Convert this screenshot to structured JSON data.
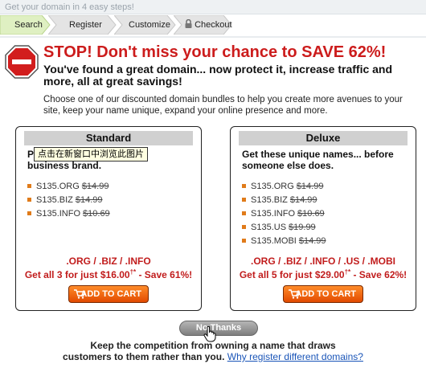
{
  "header": {
    "tagline": "Get your domain in 4 easy steps!"
  },
  "steps": [
    "Search",
    "Register",
    "Customize",
    "Checkout"
  ],
  "headline": "STOP! Don't miss your chance to SAVE 62%!",
  "subheadline": "You've found a great domain... now protect it, increase traffic and more, all at great savings!",
  "body": "Choose one of our discounted domain bundles to help you create more avenues to your site, keep your name unique, expand your online presence and more.",
  "standard": {
    "title": "Standard",
    "intro_prefix": "P",
    "intro_rest": "business brand.",
    "items": [
      {
        "name": "S135.ORG",
        "price": "$14.99"
      },
      {
        "name": "S135.BIZ",
        "price": "$14.99"
      },
      {
        "name": "S135.INFO",
        "price": "$10.69"
      }
    ],
    "tlds": ".ORG / .BIZ / .INFO",
    "deal": "Get all 3 for just $16.00",
    "deal_mark": "†*",
    "deal_save": " - Save 61%!",
    "cart": "ADD TO CART"
  },
  "deluxe": {
    "title": "Deluxe",
    "intro": "Get these unique names... before someone else does.",
    "items": [
      {
        "name": "S135.ORG",
        "price": "$14.99"
      },
      {
        "name": "S135.BIZ",
        "price": "$14.99"
      },
      {
        "name": "S135.INFO",
        "price": "$10.69"
      },
      {
        "name": "S135.US",
        "price": "$19.99"
      },
      {
        "name": "S135.MOBI",
        "price": "$14.99"
      }
    ],
    "tlds": ".ORG / .BIZ / .INFO / .US / .MOBI",
    "deal": "Get all 5 for just $29.00",
    "deal_mark": "†*",
    "deal_save": " - Save 62%!",
    "cart": "ADD TO CART"
  },
  "tooltip": "点击在新窗口中浏览此图片",
  "no_thanks": "No Thanks",
  "footer": {
    "line1": "Keep the competition from owning a name that draws",
    "line2": "customers to them rather than you.",
    "link": "Why register different domains?"
  },
  "colors": {
    "alert_red": "#cc1c1c",
    "cart_orange": "#e24a00",
    "bullet": "#e07b1a",
    "link": "#1a55b8"
  },
  "icons": [
    "stop-sign-icon",
    "lock-icon",
    "cart-icon",
    "hand-cursor-icon"
  ]
}
